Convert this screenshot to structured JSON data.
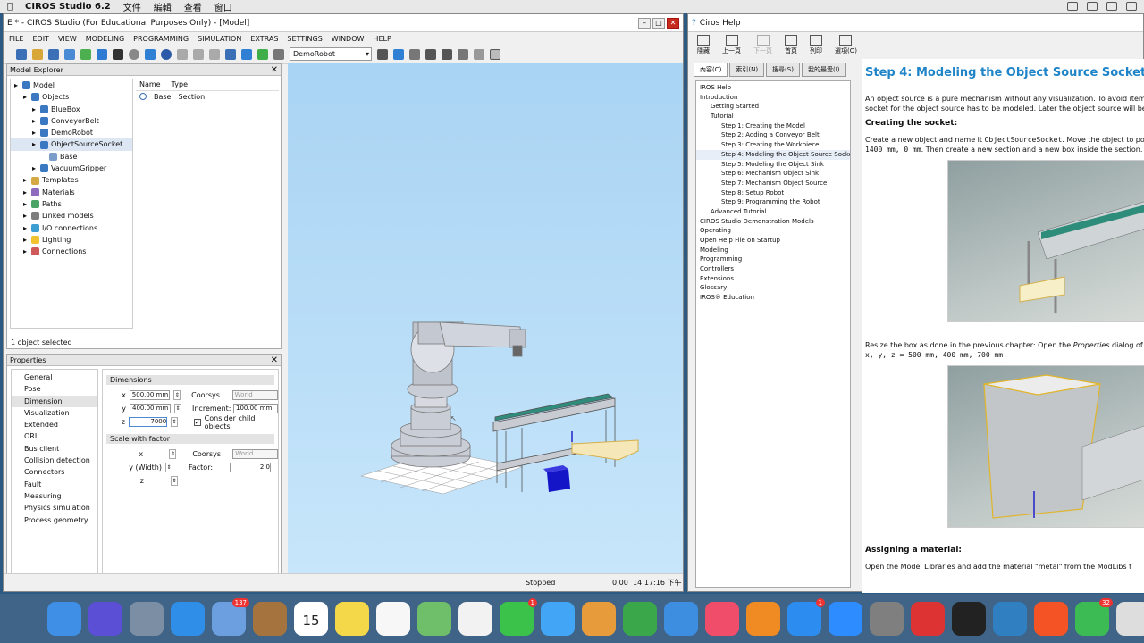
{
  "menubar": {
    "app": "CIROS Studio 6.2",
    "items": [
      "文件",
      "編輯",
      "查看",
      "窗口"
    ]
  },
  "ciros": {
    "title": "E * - CIROS Studio (For Educational Purposes Only) - [Model]",
    "menu": [
      "FILE",
      "EDIT",
      "VIEW",
      "MODELING",
      "PROGRAMMING",
      "SIMULATION",
      "EXTRAS",
      "SETTINGS",
      "WINDOW",
      "HELP"
    ],
    "robot_combo": "DemoRobot",
    "explorer_title": "Model Explorer",
    "tree": [
      {
        "label": "Model",
        "indent": 0,
        "color": "#3a78c2"
      },
      {
        "label": "Objects",
        "indent": 1,
        "color": "#3a78c2"
      },
      {
        "label": "BlueBox",
        "indent": 2,
        "color": "#3a78c2"
      },
      {
        "label": "ConveyorBelt",
        "indent": 2,
        "color": "#3a78c2"
      },
      {
        "label": "DemoRobot",
        "indent": 2,
        "color": "#3a78c2"
      },
      {
        "label": "ObjectSourceSocket",
        "indent": 2,
        "color": "#3a78c2",
        "selected": true
      },
      {
        "label": "Base",
        "indent": 3,
        "color": "#7a9ec9"
      },
      {
        "label": "VacuumGripper",
        "indent": 2,
        "color": "#3a78c2"
      },
      {
        "label": "Templates",
        "indent": 1,
        "color": "#d4a843"
      },
      {
        "label": "Materials",
        "indent": 1,
        "color": "#8e6bbf"
      },
      {
        "label": "Paths",
        "indent": 1,
        "color": "#4aa564"
      },
      {
        "label": "Linked models",
        "indent": 1,
        "color": "#7f7f7f"
      },
      {
        "label": "I/O connections",
        "indent": 1,
        "color": "#3d9fd1"
      },
      {
        "label": "Lighting",
        "indent": 1,
        "color": "#f2c230"
      },
      {
        "label": "Connections",
        "indent": 1,
        "color": "#d05a5a"
      }
    ],
    "list_headers": [
      "Name",
      "Type"
    ],
    "list_row": {
      "name": "Base",
      "type": "Section"
    },
    "selection_status": "1 object selected",
    "props_title": "Properties",
    "categories": [
      "General",
      "Pose",
      "Dimension",
      "Visualization",
      "Extended",
      "ORL",
      "Bus client",
      "Collision detection",
      "Connectors",
      "Fault",
      "Measuring",
      "Physics simulation",
      "Process geometry"
    ],
    "selected_category": "Dimension",
    "dimensions": {
      "header": "Dimensions",
      "x_label": "x",
      "x_value": "500.00 mm",
      "y_label": "y",
      "y_value": "400.00 mm",
      "z_label": "z",
      "z_value": "7000",
      "coorsys_label": "Coorsys",
      "coorsys_value": "World",
      "increment_label": "Increment:",
      "increment_value": "100.00 mm",
      "consider_label": "Consider child objects"
    },
    "scale": {
      "header": "Scale with factor",
      "x_label": "x",
      "y_label": "y (Width)",
      "z_label": "z",
      "coorsys_label": "Coorsys",
      "coorsys_value": "World",
      "factor_label": "Factor:",
      "factor_value": "2.0"
    },
    "status": {
      "state": "Stopped",
      "value": "0,00",
      "time": "14:17:16 下午"
    }
  },
  "help": {
    "title": "Ciros Help",
    "tools": [
      "隱藏",
      "上一頁",
      "下一頁",
      "首頁",
      "列印",
      "選項(O)"
    ],
    "tabs": [
      "內容(C)",
      "索引(N)",
      "搜尋(S)",
      "我的最愛(I)"
    ],
    "toc": [
      {
        "label": "IROS Help",
        "indent": 0
      },
      {
        "label": "Introduction",
        "indent": 0
      },
      {
        "label": "Getting Started",
        "indent": 1
      },
      {
        "label": "Tutorial",
        "indent": 1
      },
      {
        "label": "Step 1: Creating the Model",
        "indent": 2
      },
      {
        "label": "Step 2: Adding a Conveyor Belt",
        "indent": 2
      },
      {
        "label": "Step 3: Creating the Workpiece",
        "indent": 2
      },
      {
        "label": "Step 4: Modeling the Object Source Socket",
        "indent": 2
      },
      {
        "label": "Step 5: Modeling the Object Sink",
        "indent": 2
      },
      {
        "label": "Step 6: Mechanism Object Sink",
        "indent": 2
      },
      {
        "label": "Step 7: Mechanism Object Source",
        "indent": 2
      },
      {
        "label": "Step 8: Setup Robot",
        "indent": 2
      },
      {
        "label": "Step 9: Programming the Robot",
        "indent": 2
      },
      {
        "label": "Advanced Tutorial",
        "indent": 1
      },
      {
        "label": "CIROS Studio Demonstration Models",
        "indent": 0
      },
      {
        "label": "Operating",
        "indent": 0
      },
      {
        "label": "Open Help File on Startup",
        "indent": 0
      },
      {
        "label": "Modeling",
        "indent": 0
      },
      {
        "label": "Programming",
        "indent": 0
      },
      {
        "label": "Controllers",
        "indent": 0
      },
      {
        "label": "Extensions",
        "indent": 0
      },
      {
        "label": "Glossary",
        "indent": 0
      },
      {
        "label": "IROS® Education",
        "indent": 0
      }
    ],
    "heading": "Step 4: Modeling the Object Source Socket",
    "para1a": "An object source is a pure mechanism without any visualization. To avoid items th",
    "para1b": "socket for the object source has to be modeled. Later the object source will be pl",
    "sub1": "Creating the socket:",
    "para2a_pre": "Create a new object and name it ",
    "para2a_code": "ObjectSourceSocket",
    "para2a_post": ". Move the object to po",
    "para2b_code": "1400 mm, 0 mm",
    "para2b_post": ". Then create a new section and a new box inside the section.",
    "para3a_pre": "Resize the box as done in the previous chapter: Open the ",
    "para3a_em": "Properties",
    "para3a_post": " dialog of the",
    "para3b_code": "x, y, z = 500 mm, 400 mm, 700 mm.",
    "sub2": "Assigning a material:",
    "para4": "Open the Model Libraries and add the material \"metal\" from the ModLibs t"
  },
  "dock": [
    {
      "name": "finder",
      "color": "#3f8fe6"
    },
    {
      "name": "siri",
      "color": "#5b4fd6"
    },
    {
      "name": "launchpad",
      "color": "#7c8ea4"
    },
    {
      "name": "safari",
      "color": "#2f8fe8"
    },
    {
      "name": "mail",
      "color": "#6c9fe0",
      "badge": "137"
    },
    {
      "name": "notebook",
      "color": "#a5743e"
    },
    {
      "name": "calendar",
      "color": "#ffffff",
      "label": "15"
    },
    {
      "name": "notes",
      "color": "#f5d84a"
    },
    {
      "name": "reminders",
      "color": "#f7f7f7"
    },
    {
      "name": "maps",
      "color": "#6fbf6a"
    },
    {
      "name": "photos",
      "color": "#f2f2f2"
    },
    {
      "name": "facetime",
      "color": "#3bc24a",
      "badge": "1"
    },
    {
      "name": "messages",
      "color": "#42a5f5"
    },
    {
      "name": "preview",
      "color": "#e89b3b"
    },
    {
      "name": "numbers",
      "color": "#3aa84a"
    },
    {
      "name": "keynote",
      "color": "#3d8de0"
    },
    {
      "name": "music",
      "color": "#f04d6b"
    },
    {
      "name": "books",
      "color": "#f08a23"
    },
    {
      "name": "app-store",
      "color": "#2d8cf0",
      "badge": "1"
    },
    {
      "name": "zoom",
      "color": "#2d8cff"
    },
    {
      "name": "system-preferences",
      "color": "#7f7f7f"
    },
    {
      "name": "parallels",
      "color": "#d33"
    },
    {
      "name": "terminal",
      "color": "#222"
    },
    {
      "name": "spiral-app",
      "color": "#2f7fc1"
    },
    {
      "name": "windows",
      "color": "#f35325"
    },
    {
      "name": "kodi",
      "color": "#3cba54",
      "badge": "32"
    },
    {
      "name": "app-generic",
      "color": "#ddd"
    }
  ]
}
